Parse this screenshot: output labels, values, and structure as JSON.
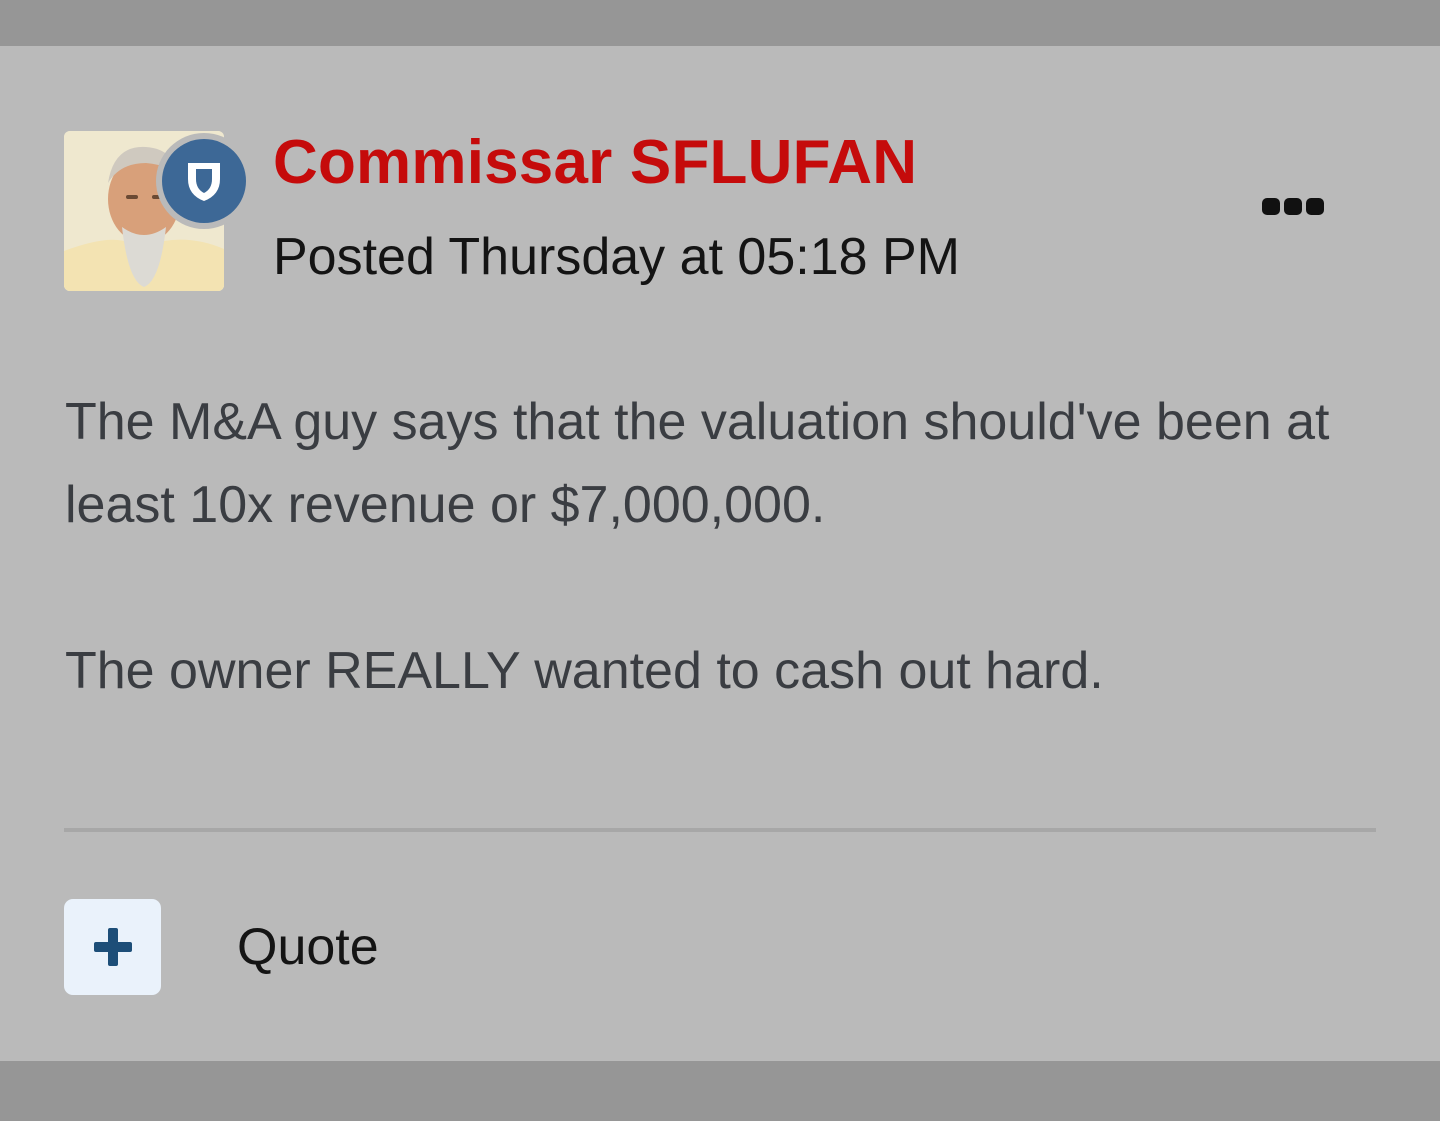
{
  "post": {
    "author": "Commissar SFLUFAN",
    "meta": "Posted Thursday at 05:18 PM",
    "body_paragraphs": [
      "The M&A guy says that the valuation should've been at least 10x revenue  or $7,000,000.",
      "The owner REALLY wanted to cash out hard."
    ]
  },
  "actions": {
    "quote_label": "Quote",
    "reaction_icon": "plus-icon",
    "more_icon": "ellipsis-icon"
  },
  "badge": {
    "icon": "shield-icon"
  },
  "colors": {
    "author_name": "#c50b0b",
    "badge": "#3d6896",
    "card_background": "#bababa",
    "page_background": "#969696",
    "reaction_button_bg": "#eaf2fb",
    "reaction_icon": "#1d4e78"
  }
}
